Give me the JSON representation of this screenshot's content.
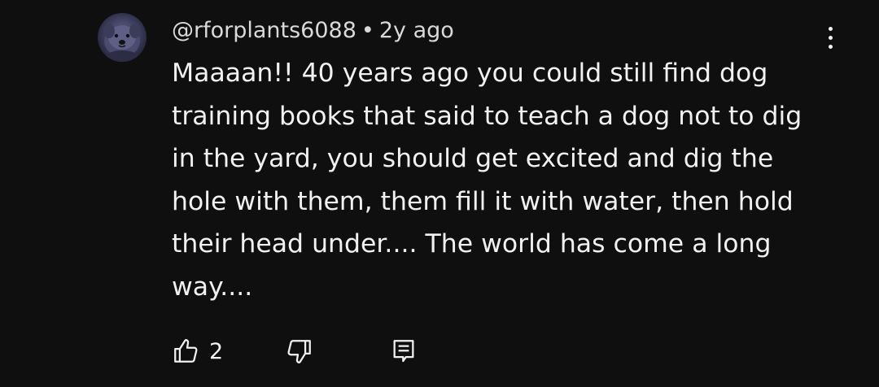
{
  "comment": {
    "author": "@rforplants6088",
    "separator": "•",
    "timestamp": "2y ago",
    "text_lines": [
      "Maaaan!! 40 years ago you could still find dog",
      "training books that said to teach a dog not to dig",
      "in the yard, you should get excited and dig the",
      "hole with them, them fill it with water, then hold",
      "their head under.... The world has come a long",
      "way...."
    ],
    "like_count": "2"
  },
  "icons": {
    "avatar": "dog-avatar",
    "more": "more-vertical-icon",
    "like": "thumbs-up-icon",
    "dislike": "thumbs-down-icon",
    "reply": "reply-comment-icon"
  },
  "colors": {
    "background": "#0f0f0f",
    "text": "#f1f1f1",
    "meta_text": "#d9d9d9"
  }
}
